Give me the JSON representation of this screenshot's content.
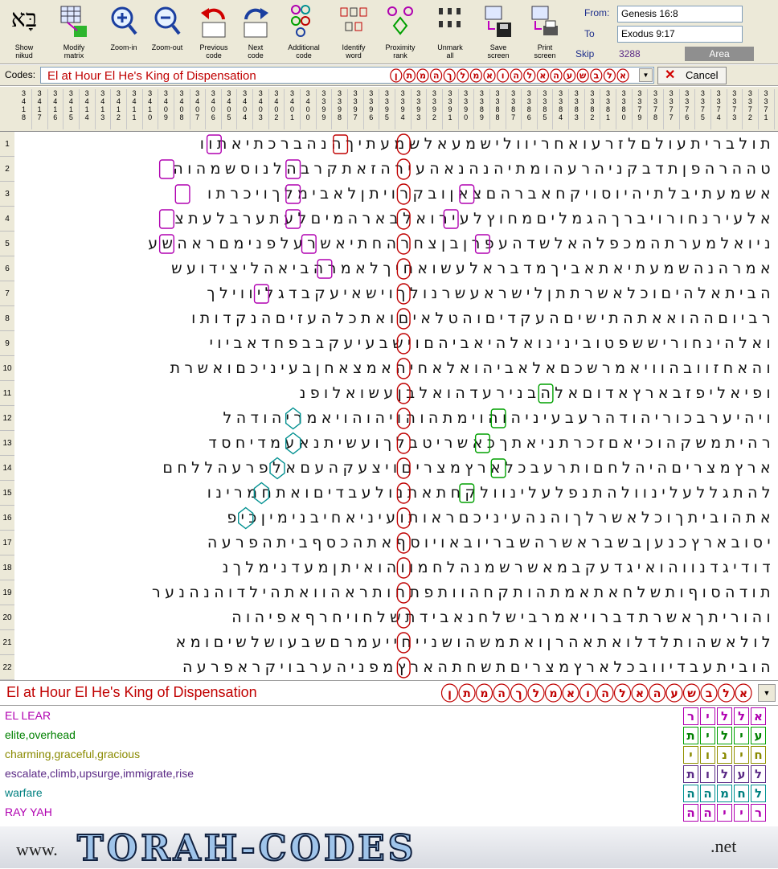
{
  "toolbar": {
    "buttons": [
      {
        "id": "show-nikud",
        "label": "Show\nnikud"
      },
      {
        "id": "modify-matrix",
        "label": "Modify\nmatrix"
      },
      {
        "id": "zoom-in",
        "label": "Zoom-in"
      },
      {
        "id": "zoom-out",
        "label": "Zoom-out"
      },
      {
        "id": "previous-code",
        "label": "Previous\ncode"
      },
      {
        "id": "next-code",
        "label": "Next\ncode"
      },
      {
        "id": "additional-code",
        "label": "Additional\ncode"
      },
      {
        "id": "identify-word",
        "label": "Identify\nword"
      },
      {
        "id": "proximity-rank",
        "label": "Proximity\nrank"
      },
      {
        "id": "unmark-all",
        "label": "Unmark\nall"
      },
      {
        "id": "save-screen",
        "label": "Save\nscreen"
      },
      {
        "id": "print-screen",
        "label": "Print\nscreen"
      }
    ],
    "show_nikud_glyph": "בָּא",
    "from_label": "From:",
    "from_value": "Genesis 16:8",
    "to_label": "To",
    "to_value": "Exodus 9:17",
    "skip_label": "Skip",
    "skip_value": "3288",
    "area_label": "Area"
  },
  "codes": {
    "label": "Codes:",
    "selected": "El at Hour El He's King of Dispensation",
    "hebrew_letters": [
      "א",
      "ל",
      "ב",
      "ש",
      "ע",
      "ה",
      "א",
      "ל",
      "ה",
      "ו",
      "א",
      "מ",
      "ל",
      "ך",
      "ה",
      "מ",
      "ת",
      "ן"
    ],
    "cancel_label": "Cancel"
  },
  "columns": [
    "3418",
    "3417",
    "3416",
    "3415",
    "3414",
    "3413",
    "3412",
    "3411",
    "3410",
    "3409",
    "3408",
    "3407",
    "3406",
    "3405",
    "3404",
    "3403",
    "3402",
    "3401",
    "3400",
    "3399",
    "3398",
    "3397",
    "3396",
    "3395",
    "3394",
    "3393",
    "3392",
    "3391",
    "3390",
    "3389",
    "3388",
    "3387",
    "3386",
    "3385",
    "3384",
    "3383",
    "3382",
    "3381",
    "3380",
    "3379",
    "3378",
    "3377",
    "3376",
    "3375",
    "3374",
    "3373",
    "3372",
    "3371"
  ],
  "rows": [
    {
      "n": "1",
      "text": "תולבריתעולםלזרעואחריוולישמעאלשמעתיךהנהברכתיאתוו"
    },
    {
      "n": "2",
      "text": "טההרהפןתדבקניהרעהומתיהנהנאהעירהזאתקרבהלנוסשמהוה"
    },
    {
      "n": "3",
      "text": "אשמעתיבלתיהיוסויקחאברהםצאןובקרויתןלאבימלךויכרתו"
    },
    {
      "n": "4",
      "text": "אלעירנחורויברךהגמליםמחוץלעירואלבארהמיםלעתערבלעתצ"
    },
    {
      "n": "5",
      "text": "ניואלמערתהמכפלהאלשדהעפרןבןצחרהחתיאשרעלפנימםראהשע"
    },
    {
      "n": "6",
      "text": "אמרהנהשמעתיאתאביךמדבראלעשואחיךלאמרהביאהליצידועש"
    },
    {
      "n": "7",
      "text": "הביתאלהיםוכלאשרתתןלישראעשרנולךוישאיעקבדגליווילך"
    },
    {
      "n": "8",
      "text": "רביוםההואאתהתישיםהעקדיםוהטלאיםואתכלהעזיםהנקדותו"
    },
    {
      "n": "9",
      "text": "ואלהינחוריששפטובינינואלהיאביהםוישבעיעקבבפחדאביוי"
    },
    {
      "n": "10",
      "text": "והאחזוובהוויאמרשכםאלאביהואלאחיהאמצאחןבעיניכםואשרת"
    },
    {
      "n": "11",
      "text": "ופיאליפזבארץאדוםאלהבנירעדהואלבןעשואלופנ"
    },
    {
      "n": "12",
      "text": "ויהיערבכוריהודהרעבעיניהוהוימתהוהויהוהויאמריהודהל"
    },
    {
      "n": "13",
      "text": "רהיתמשקהוכיאםזכרתניאתךכאשריטבלךועשיתנאעמדיחסד"
    },
    {
      "n": "14",
      "text": "ארץמצריםהיהלחםותרעבכלארץמצריםויצעקהעםאלפרעהללחם"
    },
    {
      "n": "15",
      "text": "להתגללעלינוולהתנפלעלינוולקחתאתנולעבדיםואתחמרינו"
    },
    {
      "n": "16",
      "text": "אתהוביתךוכלאשרלךוהנהעיניכםראותועיניאחיבנימיןכיפ"
    },
    {
      "n": "17",
      "text": "יסובארץכנעןבשבראשרהשבריובאויוסףאתהכסףביתהפרעה"
    },
    {
      "n": "18",
      "text": "דודיגדנווהואיגדעקבמאשרשמנהלחמווהואיתןמעדנימלךנ"
    },
    {
      "n": "19",
      "text": "תודהסוףותשלחאתאמתהותקחהוותפתחותראהוואתהילדוהנהנער"
    },
    {
      "n": "20",
      "text": "והוריתךאשרתדברויאמרבישלחנאבידתשלחויחרףאפיהוה"
    },
    {
      "n": "21",
      "text": "לולאשהותלדלואתאהרןואתמשהושנייחייעמרםשבעושלשיםומא"
    },
    {
      "n": "22",
      "text": "הוביתעבדיוובכלארץמצריםתשחתהארץמפניהערבויקראפרעה"
    }
  ],
  "highlights": {
    "main_column_index": 23,
    "main_rows": [
      1,
      2,
      3,
      4,
      5,
      6,
      7,
      8,
      9,
      10,
      11,
      12,
      13,
      14,
      15,
      16,
      17,
      18,
      19,
      20,
      21,
      22
    ],
    "marks": [
      {
        "row": 1,
        "col": 35,
        "shape": "rect",
        "color": "#b000b0"
      },
      {
        "row": 1,
        "col": 27,
        "shape": "rect",
        "color": "#c00000"
      },
      {
        "row": 2,
        "col": 38,
        "shape": "rect",
        "color": "#b000b0"
      },
      {
        "row": 2,
        "col": 30,
        "shape": "rect",
        "color": "#b000b0"
      },
      {
        "row": 3,
        "col": 37,
        "shape": "rect",
        "color": "#b000b0"
      },
      {
        "row": 3,
        "col": 19,
        "shape": "rect",
        "color": "#b000b0"
      },
      {
        "row": 3,
        "col": 30,
        "shape": "rect",
        "color": "#b000b0"
      },
      {
        "row": 4,
        "col": 38,
        "shape": "rect",
        "color": "#b000b0"
      },
      {
        "row": 4,
        "col": 30,
        "shape": "rect",
        "color": "#b000b0"
      },
      {
        "row": 4,
        "col": 20,
        "shape": "rect",
        "color": "#b000b0"
      },
      {
        "row": 5,
        "col": 38,
        "shape": "rect",
        "color": "#b000b0"
      },
      {
        "row": 5,
        "col": 29,
        "shape": "rect",
        "color": "#b000b0"
      },
      {
        "row": 5,
        "col": 18,
        "shape": "rect",
        "color": "#b000b0"
      },
      {
        "row": 6,
        "col": 28,
        "shape": "rect",
        "color": "#b000b0"
      },
      {
        "row": 7,
        "col": 32,
        "shape": "rect",
        "color": "#b000b0"
      },
      {
        "row": 11,
        "col": 14,
        "shape": "rect",
        "color": "#00a000"
      },
      {
        "row": 12,
        "col": 17,
        "shape": "rect",
        "color": "#00a000"
      },
      {
        "row": 12,
        "col": 30,
        "shape": "hex",
        "color": "#009090"
      },
      {
        "row": 13,
        "col": 18,
        "shape": "rect",
        "color": "#00a000"
      },
      {
        "row": 13,
        "col": 30,
        "shape": "hex",
        "color": "#009090"
      },
      {
        "row": 14,
        "col": 17,
        "shape": "rect",
        "color": "#00a000"
      },
      {
        "row": 14,
        "col": 31,
        "shape": "hex",
        "color": "#009090"
      },
      {
        "row": 15,
        "col": 19,
        "shape": "rect",
        "color": "#00a000"
      },
      {
        "row": 15,
        "col": 32,
        "shape": "hex",
        "color": "#009090"
      },
      {
        "row": 16,
        "col": 33,
        "shape": "hex",
        "color": "#009090"
      }
    ]
  },
  "code_row2": {
    "text": "El at Hour El He's King of Dispensation",
    "hebrew_letters": [
      "א",
      "ל",
      "ב",
      "ש",
      "ע",
      "ה",
      "א",
      "ל",
      "ה",
      "ו",
      "א",
      "מ",
      "ל",
      "ך",
      "ה",
      "מ",
      "ת",
      "ן"
    ]
  },
  "legend": [
    {
      "label": "EL LEAR",
      "color": "#b000b0",
      "letters": [
        "א",
        "ל",
        "ל",
        "י",
        "ר"
      ],
      "border": "#b000b0"
    },
    {
      "label": "elite,overhead",
      "color": "#008000",
      "letters": [
        "ע",
        "י",
        "ל",
        "י",
        "ת"
      ],
      "border": "#00a000"
    },
    {
      "label": "charming,graceful,gracious",
      "color": "#8a8a00",
      "letters": [
        "ח",
        "י",
        "נ",
        "ו",
        "י"
      ],
      "border": "#909000"
    },
    {
      "label": "escalate,climb,upsurge,immigrate,rise",
      "color": "#5b2a86",
      "letters": [
        "ל",
        "ע",
        "ל",
        "ו",
        "ת"
      ],
      "border": "#5b2a86"
    },
    {
      "label": "warfare",
      "color": "#008080",
      "letters": [
        "ל",
        "ח",
        "מ",
        "ה",
        "ה"
      ],
      "border": "#009090"
    },
    {
      "label": "RAY YAH",
      "color": "#b000b0",
      "letters": [
        "ר",
        "י",
        "י",
        "ה",
        "ה"
      ],
      "border": "#b000b0"
    }
  ],
  "banner": {
    "www": "www.",
    "main": "TORAH-CODES",
    "net": ".net"
  }
}
